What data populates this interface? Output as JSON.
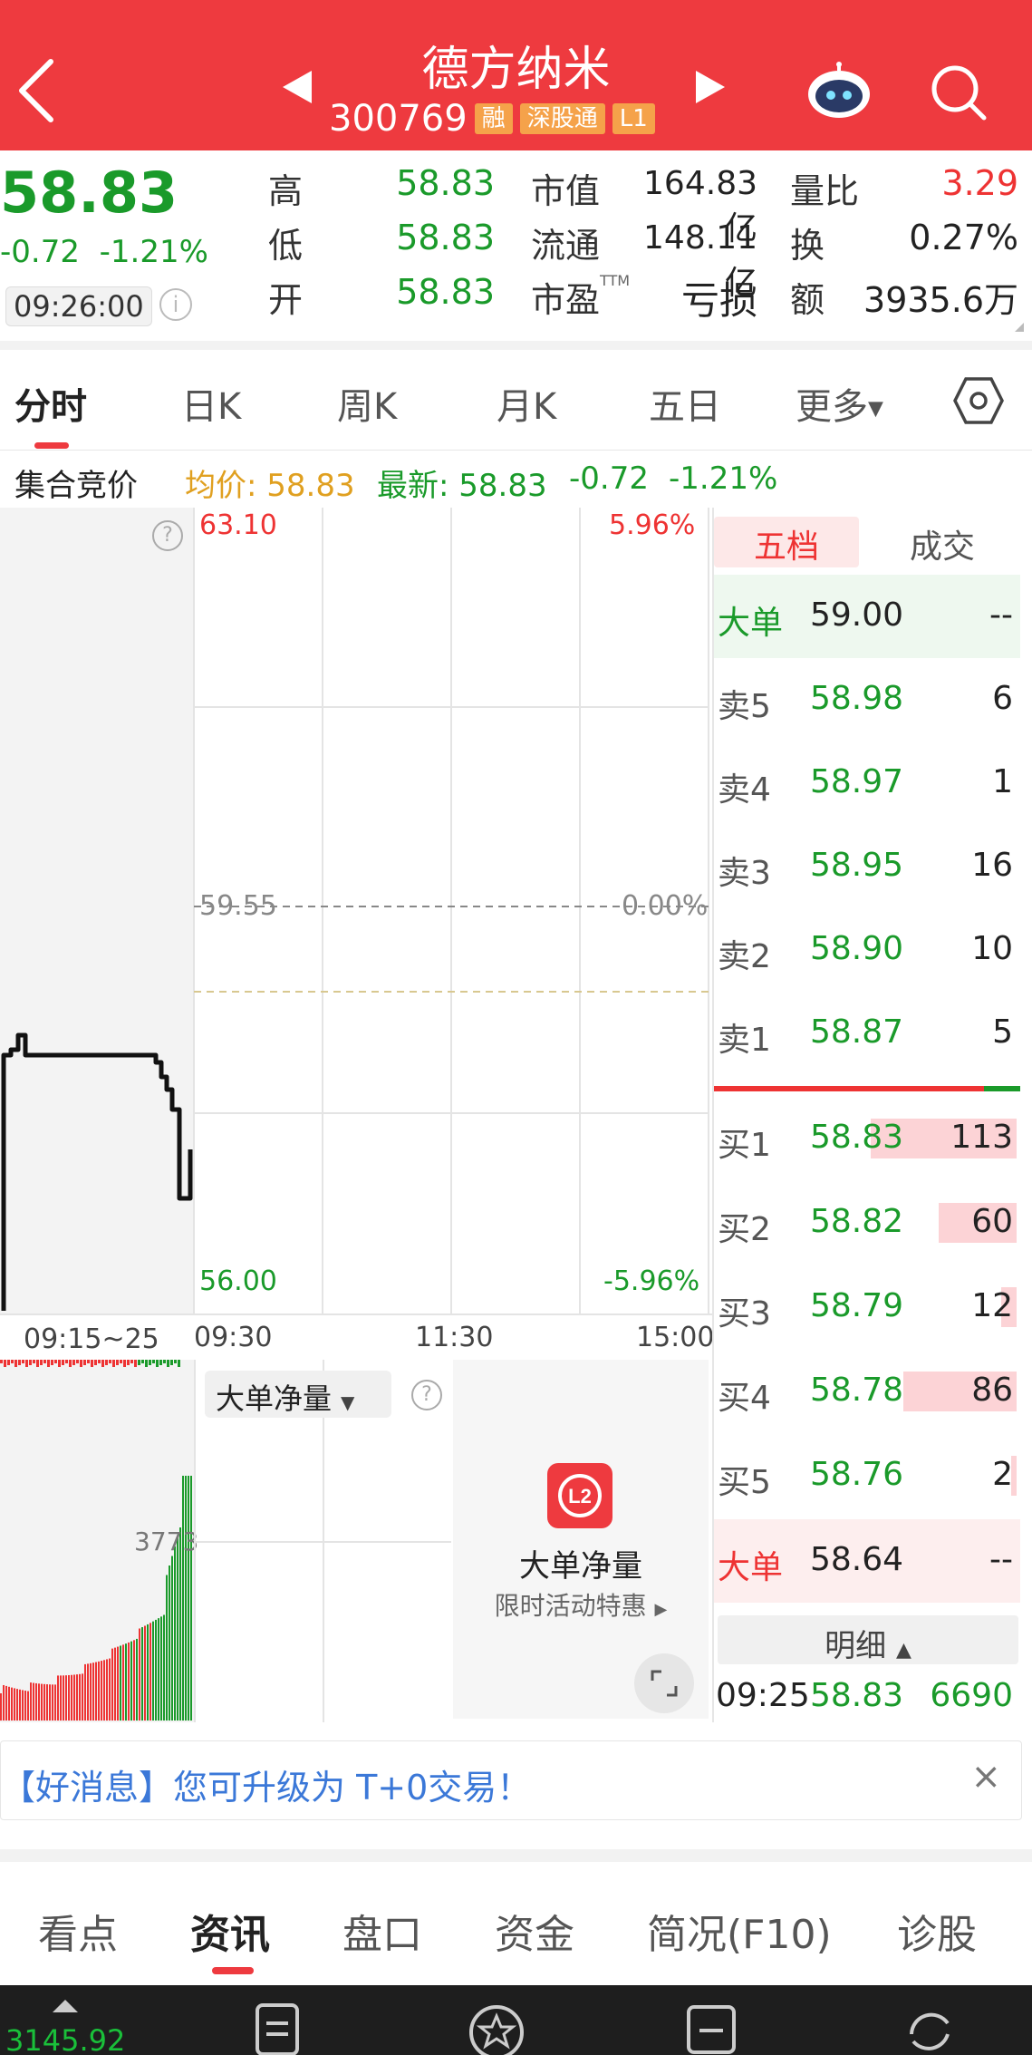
{
  "header": {
    "title": "德方纳米",
    "code": "300769",
    "tags": [
      "融",
      "深股通",
      "L1"
    ],
    "bg_color": "#ee3a3f"
  },
  "quote": {
    "price": "58.83",
    "change": "-0.72",
    "change_pct": "-1.21%",
    "time": "09:26:00",
    "rows": [
      {
        "l1": "高",
        "v1": "58.83",
        "l2": "市值",
        "v2": "164.83亿",
        "l3": "量比",
        "v3": "3.29"
      },
      {
        "l1": "低",
        "v1": "58.83",
        "l2": "流通",
        "v2": "148.11亿",
        "l3": "换",
        "v3": "0.27%"
      },
      {
        "l1": "开",
        "v1": "58.83",
        "l2": "市盈",
        "l2_sup": "TTM",
        "v2": "亏损",
        "l3": "额",
        "v3": "3935.6万"
      }
    ]
  },
  "tabs": [
    "分时",
    "日K",
    "周K",
    "月K",
    "五日",
    "更多"
  ],
  "summary": {
    "label": "集合竞价",
    "avg": "均价: 58.83",
    "latest": "最新: 58.83",
    "chg": "-0.72",
    "pct": "-1.21%"
  },
  "chart": {
    "y_top": "63.10",
    "y_mid": "59.55",
    "y_bottom": "56.00",
    "pct_top": "5.96%",
    "pct_mid": "0.00%",
    "pct_bottom": "-5.96%",
    "times": [
      "09:15~25",
      "09:30",
      "11:30",
      "15:00"
    ],
    "vol_label": "3773",
    "indicator_select": "大单净量",
    "promo_title": "大单净量",
    "promo_sub": "限时活动特惠"
  },
  "orderbook": {
    "tabs": [
      "五档",
      "成交"
    ],
    "big_sell": {
      "label": "大单",
      "price": "59.00",
      "vol": "--"
    },
    "asks": [
      {
        "label": "卖5",
        "price": "58.98",
        "vol": "6"
      },
      {
        "label": "卖4",
        "price": "58.97",
        "vol": "1"
      },
      {
        "label": "卖3",
        "price": "58.95",
        "vol": "16"
      },
      {
        "label": "卖2",
        "price": "58.90",
        "vol": "10"
      },
      {
        "label": "卖1",
        "price": "58.87",
        "vol": "5"
      }
    ],
    "bids": [
      {
        "label": "买1",
        "price": "58.83",
        "vol": "113",
        "bar": 0.67
      },
      {
        "label": "买2",
        "price": "58.82",
        "vol": "60",
        "bar": 0.36
      },
      {
        "label": "买3",
        "price": "58.79",
        "vol": "12",
        "bar": 0.07
      },
      {
        "label": "买4",
        "price": "58.78",
        "vol": "86",
        "bar": 0.52
      },
      {
        "label": "买5",
        "price": "58.76",
        "vol": "2",
        "bar": 0.02
      }
    ],
    "big_buy": {
      "label": "大单",
      "price": "58.64",
      "vol": "--"
    },
    "detail_label": "明细",
    "trade": {
      "time": "09:25",
      "price": "58.83",
      "vol": "6690"
    }
  },
  "banner": {
    "text": "【好消息】您可升级为 T+0交易！",
    "close": "×"
  },
  "bottom_tabs": [
    "看点",
    "资讯",
    "盘口",
    "资金",
    "简况(F10)",
    "诊股"
  ],
  "bottom_nav": {
    "index_value": "3145.92"
  },
  "colors": {
    "red": "#ee3a3f",
    "green": "#1a9a2a",
    "link": "#3b78d8"
  }
}
